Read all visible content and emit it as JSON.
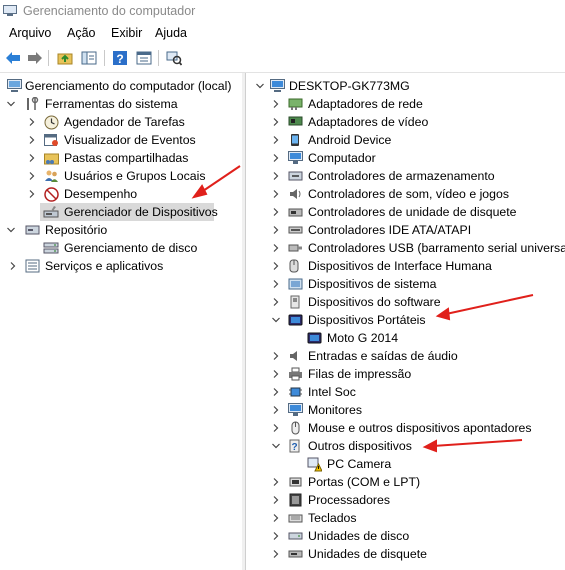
{
  "window": {
    "title": "Gerenciamento do computador"
  },
  "menu": [
    "Arquivo",
    "Ação",
    "Exibir",
    "Ajuda"
  ],
  "toolbar": {
    "icons": [
      "back-arrow-icon",
      "forward-arrow-icon",
      "up-folder-icon",
      "show-hide-tree-icon",
      "help-icon",
      "properties-icon",
      "scan-hardware-icon"
    ]
  },
  "left_tree": [
    {
      "label": "Gerenciamento do computador (local)",
      "icon": "computer-management-icon",
      "expander": ""
    },
    {
      "label": "Ferramentas do sistema",
      "icon": "tools-icon",
      "expander": "open"
    },
    {
      "label": "Agendador de Tarefas",
      "icon": "clock-icon",
      "expander": "closed"
    },
    {
      "label": "Visualizador de Eventos",
      "icon": "event-viewer-icon",
      "expander": "closed"
    },
    {
      "label": "Pastas compartilhadas",
      "icon": "shared-folder-icon",
      "expander": "closed"
    },
    {
      "label": "Usuários e Grupos Locais",
      "icon": "users-icon",
      "expander": "closed"
    },
    {
      "label": "Desempenho",
      "icon": "performance-icon",
      "expander": "closed"
    },
    {
      "label": "Gerenciador de Dispositivos",
      "icon": "device-manager-icon",
      "expander": "",
      "selected": true
    },
    {
      "label": "Repositório",
      "icon": "storage-icon",
      "expander": "open"
    },
    {
      "label": "Gerenciamento de disco",
      "icon": "disk-management-icon",
      "expander": ""
    },
    {
      "label": "Serviços e aplicativos",
      "icon": "services-icon",
      "expander": "closed"
    }
  ],
  "device_tree": [
    {
      "label": "DESKTOP-GK773MG",
      "icon": "computer-icon",
      "expander": "open"
    },
    {
      "label": "Adaptadores de rede",
      "icon": "network-adapter-icon",
      "expander": "closed"
    },
    {
      "label": "Adaptadores de vídeo",
      "icon": "display-adapter-icon",
      "expander": "closed"
    },
    {
      "label": "Android Device",
      "icon": "android-device-icon",
      "expander": "closed"
    },
    {
      "label": "Computador",
      "icon": "monitor-icon",
      "expander": "closed"
    },
    {
      "label": "Controladores de armazenamento",
      "icon": "storage-controller-icon",
      "expander": "closed"
    },
    {
      "label": "Controladores de som, vídeo e jogos",
      "icon": "sound-icon",
      "expander": "closed"
    },
    {
      "label": "Controladores de unidade de disquete",
      "icon": "floppy-controller-icon",
      "expander": "closed"
    },
    {
      "label": "Controladores IDE ATA/ATAPI",
      "icon": "ide-icon",
      "expander": "closed"
    },
    {
      "label": "Controladores USB (barramento serial universal)",
      "icon": "usb-icon",
      "expander": "closed"
    },
    {
      "label": "Dispositivos de Interface Humana",
      "icon": "hid-icon",
      "expander": "closed"
    },
    {
      "label": "Dispositivos de sistema",
      "icon": "system-device-icon",
      "expander": "closed"
    },
    {
      "label": "Dispositivos do software",
      "icon": "software-device-icon",
      "expander": "closed"
    },
    {
      "label": "Dispositivos Portáteis",
      "icon": "portable-device-icon",
      "expander": "open"
    },
    {
      "label": "Moto G 2014",
      "icon": "phone-icon",
      "expander": ""
    },
    {
      "label": "Entradas e saídas de áudio",
      "icon": "audio-io-icon",
      "expander": "closed"
    },
    {
      "label": "Filas de impressão",
      "icon": "printer-icon",
      "expander": "closed"
    },
    {
      "label": "Intel Soc",
      "icon": "chip-icon",
      "expander": "closed"
    },
    {
      "label": "Monitores",
      "icon": "monitor-icon",
      "expander": "closed"
    },
    {
      "label": "Mouse e outros dispositivos apontadores",
      "icon": "mouse-icon",
      "expander": "closed"
    },
    {
      "label": "Outros dispositivos",
      "icon": "unknown-device-icon",
      "expander": "open"
    },
    {
      "label": "PC Camera",
      "icon": "warning-device-icon",
      "expander": ""
    },
    {
      "label": "Portas (COM e LPT)",
      "icon": "port-icon",
      "expander": "closed"
    },
    {
      "label": "Processadores",
      "icon": "processor-icon",
      "expander": "closed"
    },
    {
      "label": "Teclados",
      "icon": "keyboard-icon",
      "expander": "closed"
    },
    {
      "label": "Unidades de disco",
      "icon": "disk-drive-icon",
      "expander": "closed"
    },
    {
      "label": "Unidades de disquete",
      "icon": "floppy-drive-icon",
      "expander": "closed"
    }
  ],
  "colors": {
    "selection": "#d9d9d9",
    "annotation_arrow": "#e0201b",
    "icon_blue": "#1f7bd8"
  }
}
